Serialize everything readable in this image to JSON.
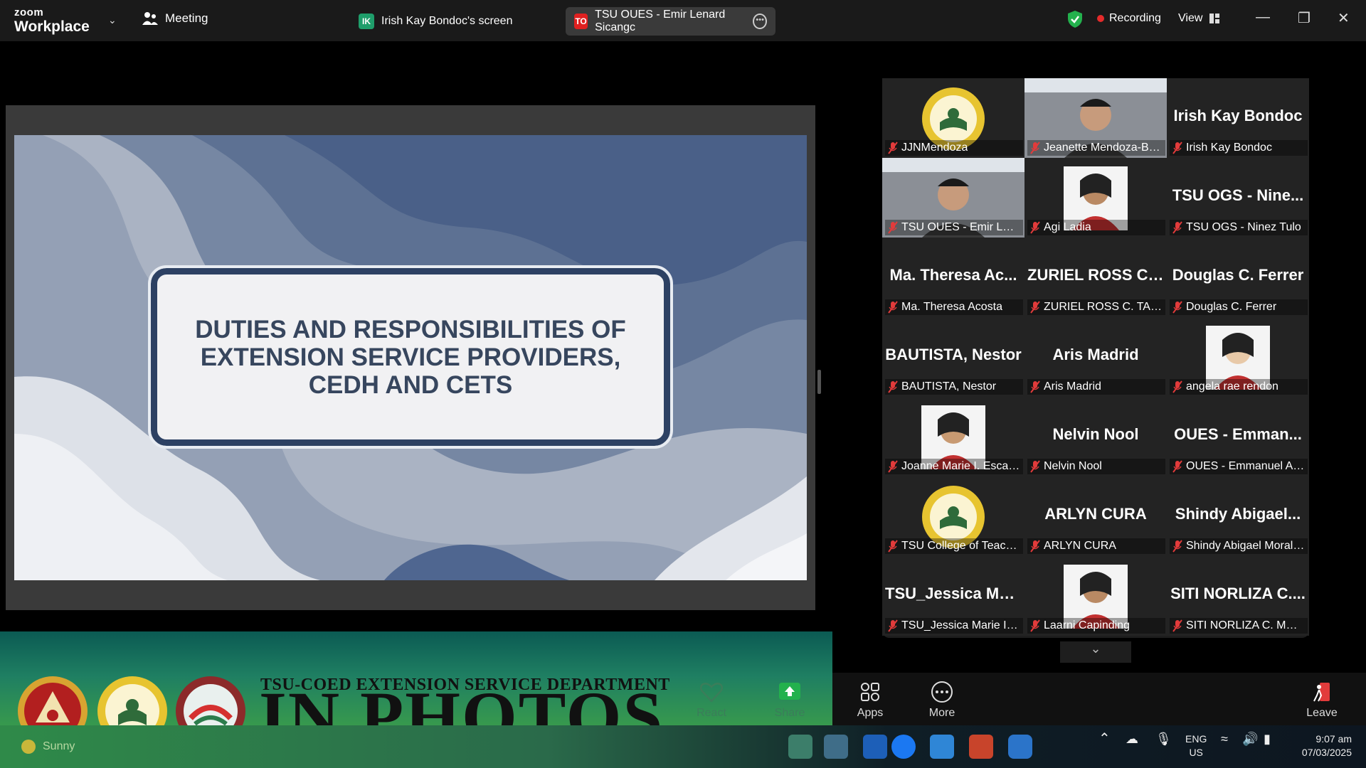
{
  "titlebar": {
    "logo_top": "zoom",
    "logo_bottom": "Workplace",
    "meeting_label": "Meeting",
    "tabs": [
      {
        "badge": "IK",
        "label": "Irish Kay Bondoc's screen"
      },
      {
        "badge": "TO",
        "label": "TSU OUES - Emir Lenard Sicangc"
      }
    ],
    "recording_label": "Recording",
    "view_label": "View"
  },
  "slide": {
    "title": "DUTIES AND RESPONSIBILITIES OF EXTENSION SERVICE PROVIDERS, CEDH AND CETS"
  },
  "gallery": {
    "tiles": [
      {
        "name": "JJNMendoza",
        "big": "",
        "kind": "logo"
      },
      {
        "name": "Jeanette Mendoza-Baq...",
        "big": "",
        "kind": "video"
      },
      {
        "name": "Irish Kay Bondoc",
        "big": "Irish Kay Bondoc",
        "kind": "text"
      },
      {
        "name": "TSU OUES - Emir Lenard ...",
        "big": "",
        "kind": "video-active"
      },
      {
        "name": "Agi Ladia",
        "big": "",
        "kind": "photo"
      },
      {
        "name": "TSU OGS - Ninez Tulo",
        "big": "TSU OGS - Nine...",
        "kind": "text"
      },
      {
        "name": "Ma. Theresa Acosta",
        "big": "Ma. Theresa Ac...",
        "kind": "text"
      },
      {
        "name": "ZURIEL ROSS C. TABIAN",
        "big": "ZURIEL ROSS C....",
        "kind": "text"
      },
      {
        "name": "Douglas C. Ferrer",
        "big": "Douglas C. Ferrer",
        "kind": "text"
      },
      {
        "name": "BAUTISTA, Nestor",
        "big": "BAUTISTA, Nestor",
        "kind": "text"
      },
      {
        "name": "Aris Madrid",
        "big": "Aris Madrid",
        "kind": "text"
      },
      {
        "name": "angela rae rendon",
        "big": "",
        "kind": "photo"
      },
      {
        "name": "Joanne Marie I. Escalona",
        "big": "",
        "kind": "photo"
      },
      {
        "name": "Nelvin Nool",
        "big": "Nelvin Nool",
        "kind": "text"
      },
      {
        "name": "OUES - Emmanuel Adr...",
        "big": "OUES - Emman...",
        "kind": "text"
      },
      {
        "name": "TSU College of Teacher...",
        "big": "",
        "kind": "logo"
      },
      {
        "name": "ARLYN CURA",
        "big": "ARLYN CURA",
        "kind": "text"
      },
      {
        "name": "Shindy Abigael Morales",
        "big": "Shindy Abigael...",
        "kind": "text"
      },
      {
        "name": "TSU_Jessica Marie I. D...",
        "big": "TSU_Jessica Mar...",
        "kind": "text"
      },
      {
        "name": "Laarni Capinding",
        "big": "",
        "kind": "photo"
      },
      {
        "name": "SITI NORLIZA C. MUSA",
        "big": "SITI NORLIZA C....",
        "kind": "text"
      }
    ]
  },
  "banner": {
    "subtitle": "TSU-COED EXTENSION SERVICE DEPARTMENT",
    "title": "IN PHOTOS"
  },
  "toolbar": {
    "react_label": "React",
    "share_label": "Share",
    "apps_label": "Apps",
    "more_label": "More",
    "leave_label": "Leave"
  },
  "taskbar": {
    "weather": "Sunny",
    "lang_top": "ENG",
    "lang_bottom": "US",
    "time": "9:07 am",
    "date": "07/03/2025"
  },
  "colors": {
    "active_speaker": "#2ecf7a",
    "recording_dot": "#e52b2b",
    "slide_title": "#37465e"
  }
}
